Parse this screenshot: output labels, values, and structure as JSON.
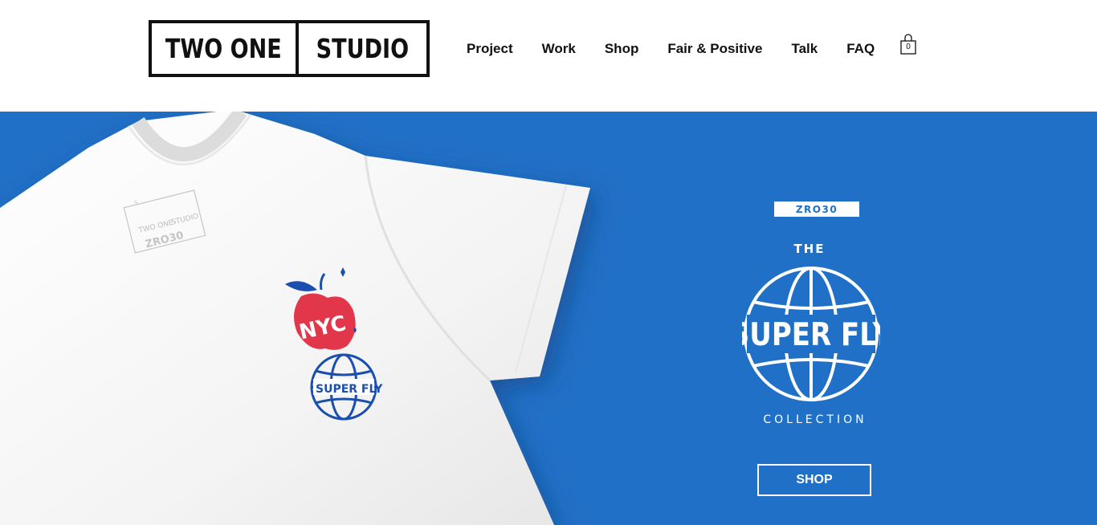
{
  "header": {
    "logo": {
      "left": "TWO ONE",
      "right": "STUDIO"
    },
    "nav": [
      {
        "label": "Project"
      },
      {
        "label": "Work"
      },
      {
        "label": "Shop"
      },
      {
        "label": "Fair & Positive"
      },
      {
        "label": "Talk"
      },
      {
        "label": "FAQ"
      }
    ],
    "cart_count": "0"
  },
  "hero": {
    "badge": "ZRO30",
    "the": "THE",
    "collection_title": "SUPER FLY",
    "collection": "COLLECTION",
    "shop_button": "SHOP",
    "tshirt_graphics": {
      "label_brand_left": "TWO ONE",
      "label_brand_right": "STUDIO",
      "label_code": "ZRO30",
      "label_size": "S",
      "apple_text": "NYC",
      "globe_text": "SUPER FLY"
    }
  },
  "colors": {
    "hero_bg": "#2170c7",
    "accent_red": "#e2374a",
    "print_blue": "#1a4fb0",
    "text_dark": "#111111",
    "white": "#ffffff"
  }
}
